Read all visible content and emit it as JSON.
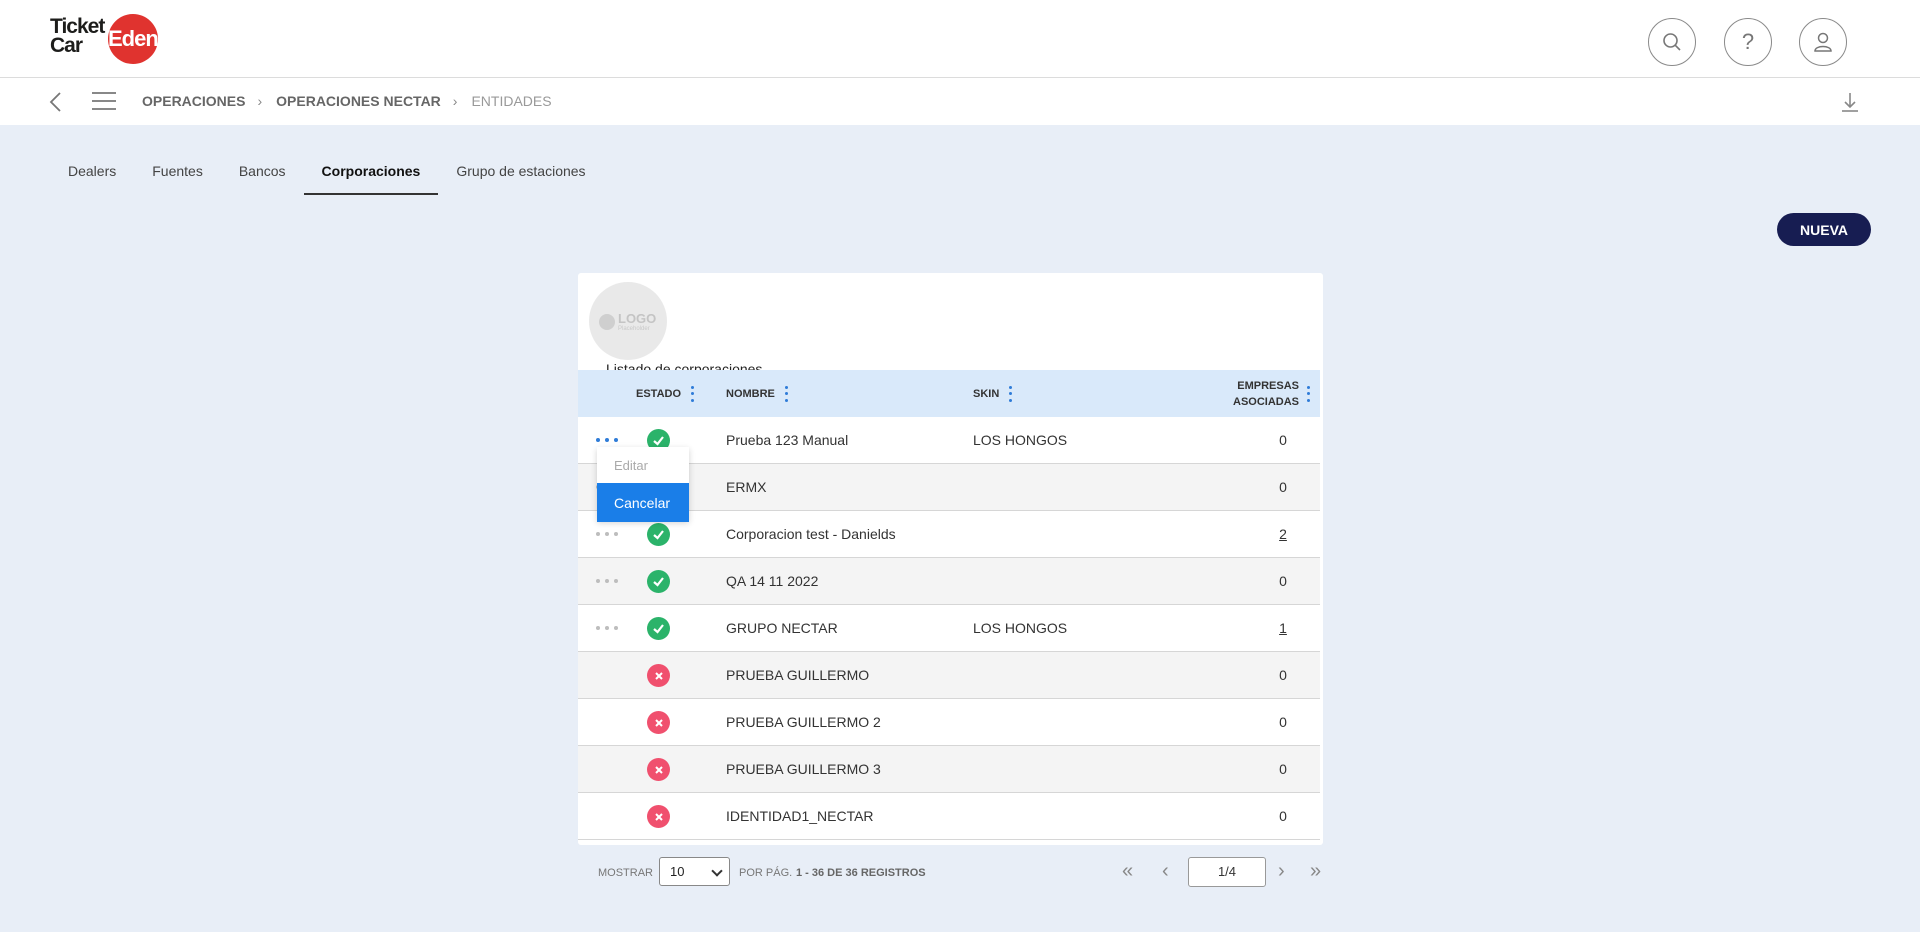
{
  "header": {
    "logo_text_left": "Ticket Car",
    "logo_text_right": "Edenred",
    "search_icon": "search-icon",
    "help_icon": "help-icon",
    "user_icon": "user-icon"
  },
  "breadcrumb": {
    "items": [
      "OPERACIONES",
      "OPERACIONES NECTAR",
      "ENTIDADES"
    ]
  },
  "tabs": [
    {
      "label": "Dealers",
      "active": false
    },
    {
      "label": "Fuentes",
      "active": false
    },
    {
      "label": "Bancos",
      "active": false
    },
    {
      "label": "Corporaciones",
      "active": true
    },
    {
      "label": "Grupo de estaciones",
      "active": false
    }
  ],
  "new_button": "NUEVA",
  "card": {
    "logo_placeholder": "LOGO",
    "logo_placeholder_sub": "Placeholder",
    "title": "Listado de corporaciones",
    "columns": {
      "estado": "ESTADO",
      "nombre": "NOMBRE",
      "skin": "SKIN",
      "empresas_line1": "EMPRESAS",
      "empresas_line2": "ASOCIADAS"
    },
    "rows": [
      {
        "active": true,
        "name": "Prueba 123 Manual",
        "skin": "LOS HONGOS",
        "count": "0",
        "count_link": false
      },
      {
        "active": true,
        "name": "ERMX",
        "skin": "",
        "count": "0",
        "count_link": false
      },
      {
        "active": true,
        "name": "Corporacion test - Danields",
        "skin": "",
        "count": "2",
        "count_link": true
      },
      {
        "active": true,
        "name": "QA 14 11 2022",
        "skin": "",
        "count": "0",
        "count_link": false
      },
      {
        "active": true,
        "name": "GRUPO NECTAR",
        "skin": "LOS HONGOS",
        "count": "1",
        "count_link": true
      },
      {
        "active": false,
        "name": "PRUEBA GUILLERMO",
        "skin": "",
        "count": "0",
        "count_link": false
      },
      {
        "active": false,
        "name": "PRUEBA GUILLERMO 2",
        "skin": "",
        "count": "0",
        "count_link": false
      },
      {
        "active": false,
        "name": "PRUEBA GUILLERMO 3",
        "skin": "",
        "count": "0",
        "count_link": false
      },
      {
        "active": false,
        "name": "IDENTIDAD1_NECTAR",
        "skin": "",
        "count": "0",
        "count_link": false
      }
    ],
    "menu": {
      "edit": "Editar",
      "cancel": "Cancelar"
    }
  },
  "pagination": {
    "show_label": "MOSTRAR",
    "page_size": "10",
    "per_page_label": "POR PÁG.",
    "records": "1 - 36 DE 36 REGISTROS",
    "page": "1/4"
  },
  "colors": {
    "active_status": "#2bb36a",
    "inactive_status": "#f0506e",
    "primary_button": "#171d52",
    "menu_highlight": "#1a7ee8",
    "table_header": "#d9e9fa"
  }
}
